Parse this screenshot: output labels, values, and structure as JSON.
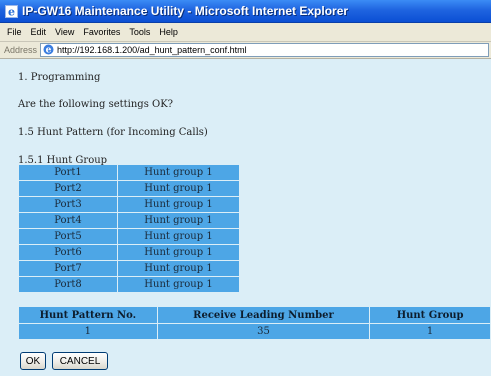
{
  "window": {
    "title": "IP-GW16 Maintenance Utility - Microsoft Internet Explorer"
  },
  "menu": [
    "File",
    "Edit",
    "View",
    "Favorites",
    "Tools",
    "Help"
  ],
  "address": {
    "label": "Address",
    "url": "http://192.168.1.200/ad_hunt_pattern_conf.html"
  },
  "page": {
    "section": "1. Programming",
    "question": "Are the following settings OK?",
    "subsection": "1.5 Hunt Pattern (for Incoming Calls)",
    "group_heading": "1.5.1 Hunt Group",
    "hunt_rows": [
      [
        "Port1",
        "Hunt group 1"
      ],
      [
        "Port2",
        "Hunt group 1"
      ],
      [
        "Port3",
        "Hunt group 1"
      ],
      [
        "Port4",
        "Hunt group 1"
      ],
      [
        "Port5",
        "Hunt group 1"
      ],
      [
        "Port6",
        "Hunt group 1"
      ],
      [
        "Port7",
        "Hunt group 1"
      ],
      [
        "Port8",
        "Hunt group 1"
      ]
    ],
    "pattern_table": {
      "headers": [
        "Hunt Pattern No.",
        "Receive Leading Number",
        "Hunt Group"
      ],
      "rows": [
        [
          "1",
          "35",
          "1"
        ]
      ]
    },
    "buttons": {
      "ok": "OK",
      "cancel": "CANCEL"
    }
  }
}
